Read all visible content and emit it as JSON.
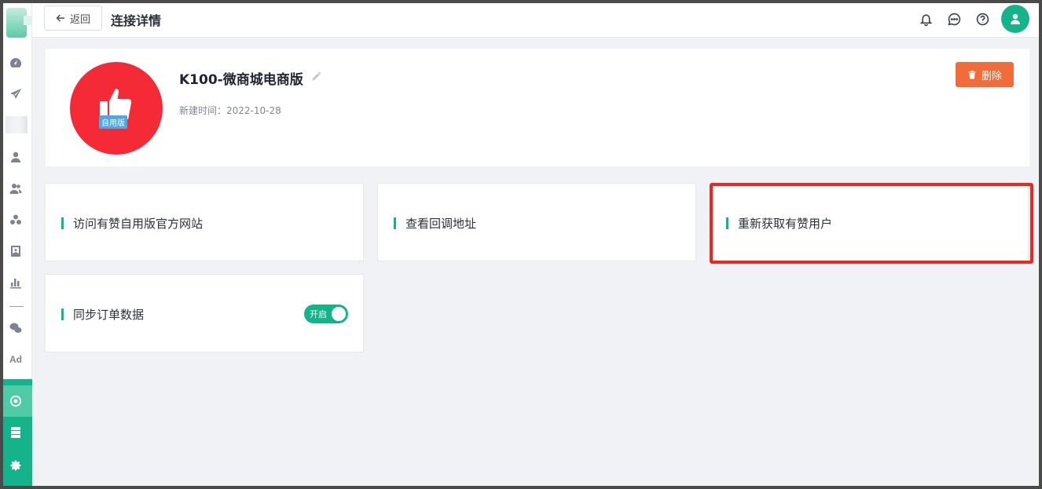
{
  "header": {
    "back_label": "返回",
    "title": "连接详情"
  },
  "topbar_icons": [
    "bell-icon",
    "chat-icon",
    "help-icon",
    "user-icon"
  ],
  "app": {
    "name": "K100-微商城电商版",
    "created_label": "新建时间：2022-10-28",
    "logo_tag": "自用版"
  },
  "delete_label": "删除",
  "cards": [
    {
      "label": "访问有赞自用版官方网站"
    },
    {
      "label": "查看回调地址"
    },
    {
      "label": "重新获取有赞用户"
    },
    {
      "label": "同步订单数据",
      "toggle_label": "开启",
      "toggle_on": true
    }
  ],
  "sidebar": {
    "ad_label": "Ad",
    "icons": [
      "dashboard-icon",
      "send-icon",
      "user-icon",
      "users-icon",
      "cluster-icon",
      "contact-card-icon",
      "bar-chart-icon",
      "wechat-icon",
      "ad-icon",
      "connector-icon",
      "server-icon",
      "settings-icon"
    ]
  },
  "colors": {
    "primary": "#15b389",
    "danger": "#f26b3a",
    "highlight": "#f5231b",
    "logo_red": "#f42b37"
  }
}
